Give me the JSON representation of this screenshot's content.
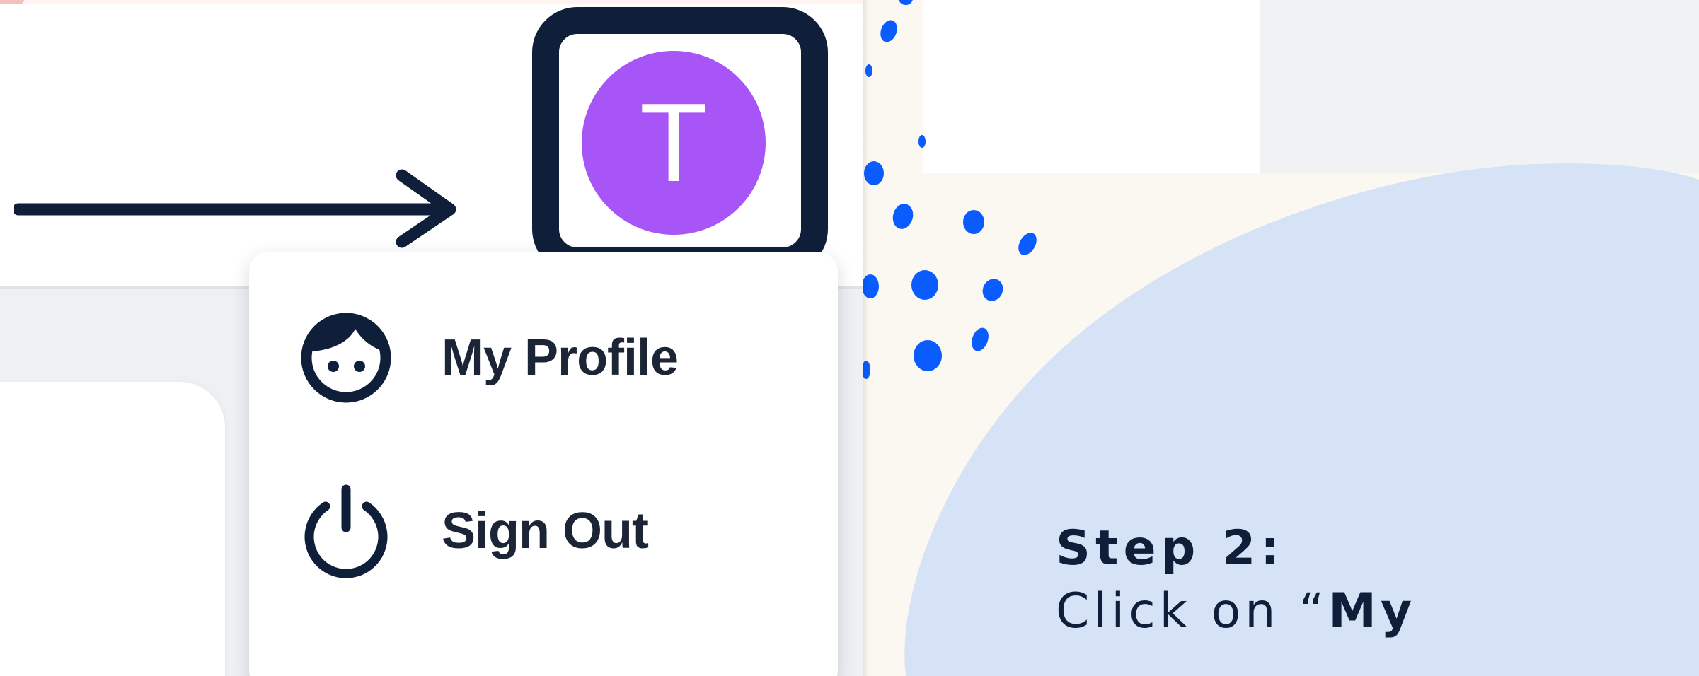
{
  "avatar": {
    "initial": "T",
    "color": "#a855f7"
  },
  "user_menu": {
    "items": [
      {
        "label": "My Profile",
        "icon": "user-face-icon"
      },
      {
        "label": "Sign Out",
        "icon": "power-icon"
      }
    ]
  },
  "instruction": {
    "step_label": "Step 2:",
    "body_prefix": "Click on “",
    "body_emphasis": "My"
  },
  "colors": {
    "navy": "#0f1f3a",
    "avatar_purple": "#a855f7",
    "dot_blue": "#0b5cff",
    "blob_blue": "#d6e2f6",
    "cream_background": "#fbf7f1"
  }
}
